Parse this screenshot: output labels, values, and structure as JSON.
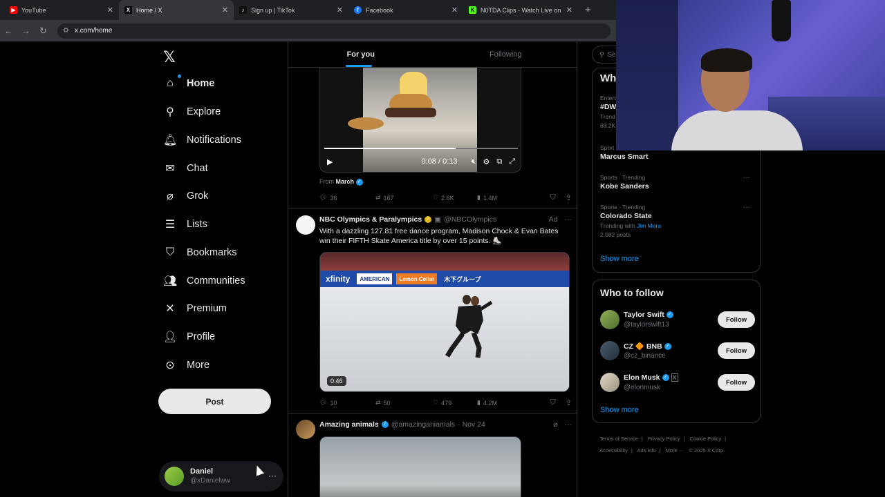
{
  "browser": {
    "tabs": [
      {
        "title": "YouTube",
        "fav_color": "#ff0000",
        "fav_glyph": "▶",
        "active": false
      },
      {
        "title": "Home / X",
        "fav_color": "#000000",
        "fav_glyph": "X",
        "active": true
      },
      {
        "title": "Sign up | TikTok",
        "fav_color": "#111111",
        "fav_glyph": "♪",
        "active": false
      },
      {
        "title": "Facebook",
        "fav_color": "#1877f2",
        "fav_glyph": "f",
        "active": false
      },
      {
        "title": "N0TDA Clips - Watch Live on K",
        "fav_color": "#53fc18",
        "fav_glyph": "K",
        "active": false
      }
    ],
    "url": "x.com/home"
  },
  "nav": {
    "items": [
      {
        "label": "Home",
        "icon": "home-icon"
      },
      {
        "label": "Explore",
        "icon": "search-icon"
      },
      {
        "label": "Notifications",
        "icon": "bell-icon"
      },
      {
        "label": "Chat",
        "icon": "mail-icon"
      },
      {
        "label": "Grok",
        "icon": "grok-icon"
      },
      {
        "label": "Lists",
        "icon": "list-icon"
      },
      {
        "label": "Bookmarks",
        "icon": "bookmark-icon"
      },
      {
        "label": "Communities",
        "icon": "people-icon"
      },
      {
        "label": "Premium",
        "icon": "x-logo-icon"
      },
      {
        "label": "Profile",
        "icon": "person-icon"
      },
      {
        "label": "More",
        "icon": "more-circle-icon"
      }
    ],
    "post_label": "Post",
    "account": {
      "name": "Daniel",
      "handle": "@xDanielww"
    }
  },
  "feed": {
    "tabs": [
      "For you",
      "Following"
    ],
    "post1": {
      "video_time": "0:08 / 0:13",
      "progress": 0.68,
      "from_label": "From",
      "from_name": "March",
      "replies": "36",
      "reposts": "167",
      "likes": "2.6K",
      "views": "1.4M"
    },
    "post2": {
      "name": "NBC Olympics & Paralympics",
      "handle": "@NBCOlympics",
      "ad_label": "Ad",
      "text": "With a dazzling 127.81 free dance program, Madison Chock & Evan Bates win their FIFTH Skate America title by over 15 points. ⛸️",
      "boards": [
        "xfinity",
        "AMERICAN",
        "Lemon Cellar",
        "木下グループ"
      ],
      "duration": "0:46",
      "replies": "10",
      "reposts": "50",
      "likes": "479",
      "views": "4.2M"
    },
    "post3": {
      "name": "Amazing animals",
      "handle": "@amazinganiamals",
      "date": "· Nov 24"
    }
  },
  "right": {
    "search_placeholder": "Se",
    "trends_title": "Wh",
    "trends": [
      {
        "meta": "Entert",
        "name": "#DW",
        "sub": "Trend",
        "sub2": "88.2K"
      },
      {
        "meta": "Sport",
        "name": "Marcus Smart",
        "sub": ""
      },
      {
        "meta": "Sports · Trending",
        "name": "Kobe Sanders",
        "sub": ""
      },
      {
        "meta": "Sports · Trending",
        "name": "Colorado State",
        "sub": "Trending with",
        "sub_link": "Jim Mora",
        "posts": "2,082 posts"
      }
    ],
    "show_more": "Show more",
    "wtf_title": "Who to follow",
    "wtf": [
      {
        "name": "Taylor Swift",
        "handle": "@taylorswift13",
        "button": "Follow",
        "avatar_color": "#7a9a4a",
        "badge": "blue"
      },
      {
        "name": "CZ 🔶 BNB",
        "handle": "@cz_binance",
        "button": "Follow",
        "avatar_color": "#3a4a5a",
        "badge": "blue"
      },
      {
        "name": "Elon Musk",
        "handle": "@elonmusk",
        "button": "Follow",
        "avatar_color": "#c9c2b0",
        "badge": "blue"
      }
    ],
    "wtf_show_more": "Show more",
    "footer": [
      "Terms of Service",
      "|",
      "Privacy Policy",
      "|",
      "Cookie Policy",
      "|",
      "Accessibility",
      "|",
      "Ads info",
      "|",
      "More ···",
      "© 2025 X Corp."
    ]
  },
  "colors": {
    "accent": "#1d9bf0",
    "border": "#2f3336",
    "muted": "#71767b"
  }
}
